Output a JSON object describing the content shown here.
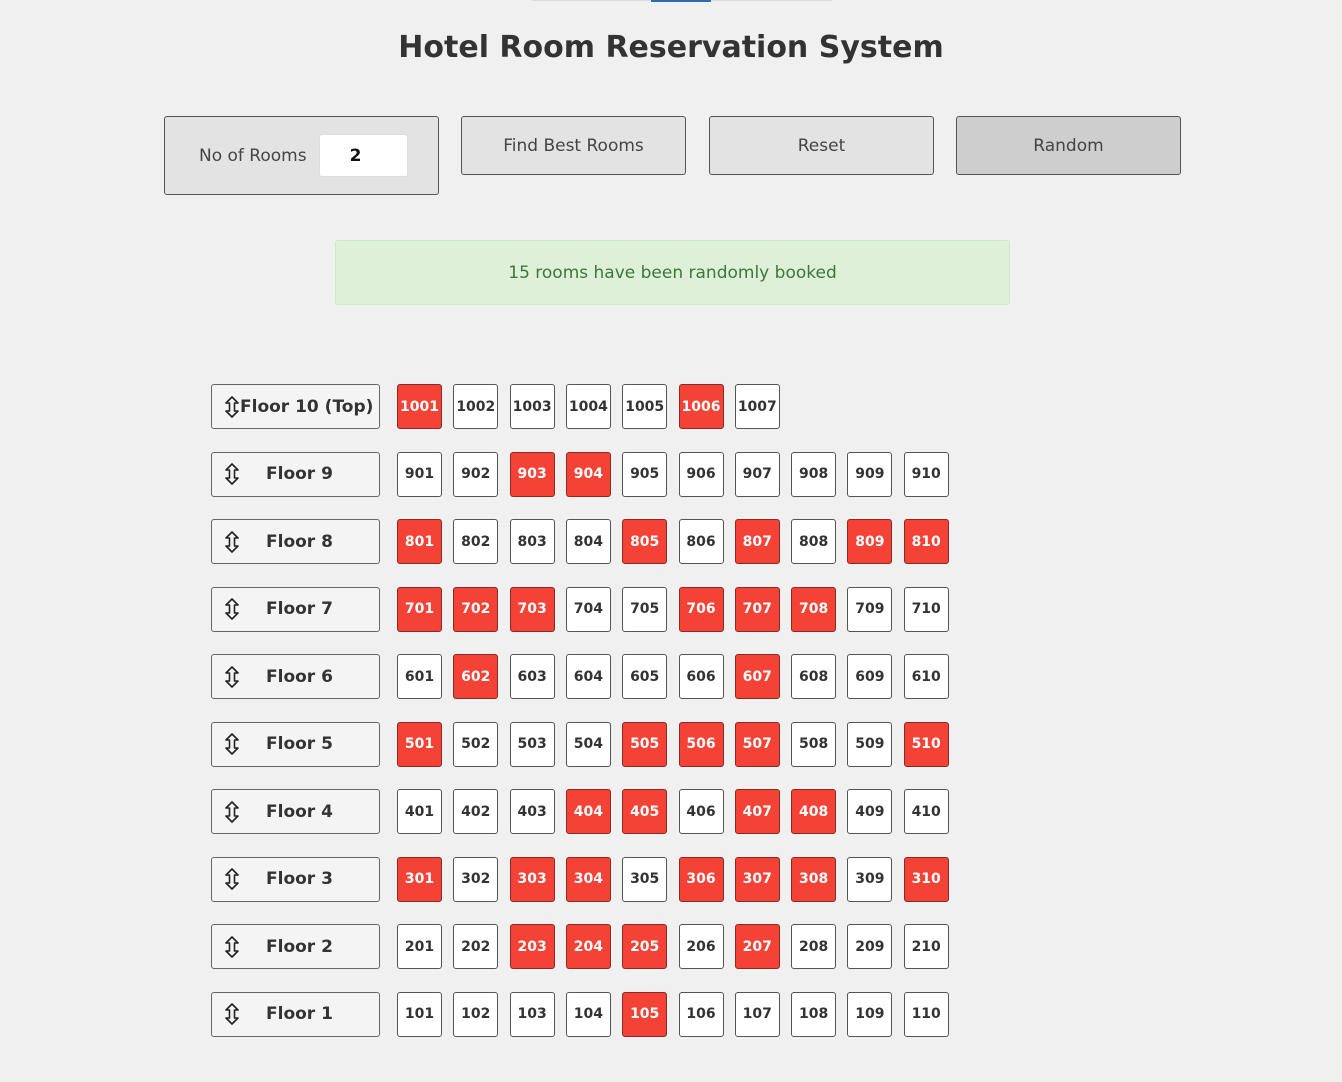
{
  "title": "Hotel Room Reservation System",
  "controls": {
    "rooms_label": "No of Rooms",
    "rooms_value": "2",
    "find_label": "Find Best Rooms",
    "reset_label": "Reset",
    "random_label": "Random"
  },
  "alert": {
    "message": "15 rooms have been randomly booked"
  },
  "colors": {
    "booked": "#f44336",
    "available": "#ffffff",
    "alert_bg": "#dff0d8",
    "alert_text": "#3c763d"
  },
  "floors": [
    {
      "label": "Floor 10 (Top)",
      "rooms": [
        {
          "number": "1001",
          "booked": true
        },
        {
          "number": "1002",
          "booked": false
        },
        {
          "number": "1003",
          "booked": false
        },
        {
          "number": "1004",
          "booked": false
        },
        {
          "number": "1005",
          "booked": false
        },
        {
          "number": "1006",
          "booked": true
        },
        {
          "number": "1007",
          "booked": false
        }
      ]
    },
    {
      "label": "Floor 9",
      "rooms": [
        {
          "number": "901",
          "booked": false
        },
        {
          "number": "902",
          "booked": false
        },
        {
          "number": "903",
          "booked": true
        },
        {
          "number": "904",
          "booked": true
        },
        {
          "number": "905",
          "booked": false
        },
        {
          "number": "906",
          "booked": false
        },
        {
          "number": "907",
          "booked": false
        },
        {
          "number": "908",
          "booked": false
        },
        {
          "number": "909",
          "booked": false
        },
        {
          "number": "910",
          "booked": false
        }
      ]
    },
    {
      "label": "Floor 8",
      "rooms": [
        {
          "number": "801",
          "booked": true
        },
        {
          "number": "802",
          "booked": false
        },
        {
          "number": "803",
          "booked": false
        },
        {
          "number": "804",
          "booked": false
        },
        {
          "number": "805",
          "booked": true
        },
        {
          "number": "806",
          "booked": false
        },
        {
          "number": "807",
          "booked": true
        },
        {
          "number": "808",
          "booked": false
        },
        {
          "number": "809",
          "booked": true
        },
        {
          "number": "810",
          "booked": true
        }
      ]
    },
    {
      "label": "Floor 7",
      "rooms": [
        {
          "number": "701",
          "booked": true
        },
        {
          "number": "702",
          "booked": true
        },
        {
          "number": "703",
          "booked": true
        },
        {
          "number": "704",
          "booked": false
        },
        {
          "number": "705",
          "booked": false
        },
        {
          "number": "706",
          "booked": true
        },
        {
          "number": "707",
          "booked": true
        },
        {
          "number": "708",
          "booked": true
        },
        {
          "number": "709",
          "booked": false
        },
        {
          "number": "710",
          "booked": false
        }
      ]
    },
    {
      "label": "Floor 6",
      "rooms": [
        {
          "number": "601",
          "booked": false
        },
        {
          "number": "602",
          "booked": true
        },
        {
          "number": "603",
          "booked": false
        },
        {
          "number": "604",
          "booked": false
        },
        {
          "number": "605",
          "booked": false
        },
        {
          "number": "606",
          "booked": false
        },
        {
          "number": "607",
          "booked": true
        },
        {
          "number": "608",
          "booked": false
        },
        {
          "number": "609",
          "booked": false
        },
        {
          "number": "610",
          "booked": false
        }
      ]
    },
    {
      "label": "Floor 5",
      "rooms": [
        {
          "number": "501",
          "booked": true
        },
        {
          "number": "502",
          "booked": false
        },
        {
          "number": "503",
          "booked": false
        },
        {
          "number": "504",
          "booked": false
        },
        {
          "number": "505",
          "booked": true
        },
        {
          "number": "506",
          "booked": true
        },
        {
          "number": "507",
          "booked": true
        },
        {
          "number": "508",
          "booked": false
        },
        {
          "number": "509",
          "booked": false
        },
        {
          "number": "510",
          "booked": true
        }
      ]
    },
    {
      "label": "Floor 4",
      "rooms": [
        {
          "number": "401",
          "booked": false
        },
        {
          "number": "402",
          "booked": false
        },
        {
          "number": "403",
          "booked": false
        },
        {
          "number": "404",
          "booked": true
        },
        {
          "number": "405",
          "booked": true
        },
        {
          "number": "406",
          "booked": false
        },
        {
          "number": "407",
          "booked": true
        },
        {
          "number": "408",
          "booked": true
        },
        {
          "number": "409",
          "booked": false
        },
        {
          "number": "410",
          "booked": false
        }
      ]
    },
    {
      "label": "Floor 3",
      "rooms": [
        {
          "number": "301",
          "booked": true
        },
        {
          "number": "302",
          "booked": false
        },
        {
          "number": "303",
          "booked": true
        },
        {
          "number": "304",
          "booked": true
        },
        {
          "number": "305",
          "booked": false
        },
        {
          "number": "306",
          "booked": true
        },
        {
          "number": "307",
          "booked": true
        },
        {
          "number": "308",
          "booked": true
        },
        {
          "number": "309",
          "booked": false
        },
        {
          "number": "310",
          "booked": true
        }
      ]
    },
    {
      "label": "Floor 2",
      "rooms": [
        {
          "number": "201",
          "booked": false
        },
        {
          "number": "202",
          "booked": false
        },
        {
          "number": "203",
          "booked": true
        },
        {
          "number": "204",
          "booked": true
        },
        {
          "number": "205",
          "booked": true
        },
        {
          "number": "206",
          "booked": false
        },
        {
          "number": "207",
          "booked": true
        },
        {
          "number": "208",
          "booked": false
        },
        {
          "number": "209",
          "booked": false
        },
        {
          "number": "210",
          "booked": false
        }
      ]
    },
    {
      "label": "Floor 1",
      "rooms": [
        {
          "number": "101",
          "booked": false
        },
        {
          "number": "102",
          "booked": false
        },
        {
          "number": "103",
          "booked": false
        },
        {
          "number": "104",
          "booked": false
        },
        {
          "number": "105",
          "booked": true
        },
        {
          "number": "106",
          "booked": false
        },
        {
          "number": "107",
          "booked": false
        },
        {
          "number": "108",
          "booked": false
        },
        {
          "number": "109",
          "booked": false
        },
        {
          "number": "110",
          "booked": false
        }
      ]
    }
  ]
}
